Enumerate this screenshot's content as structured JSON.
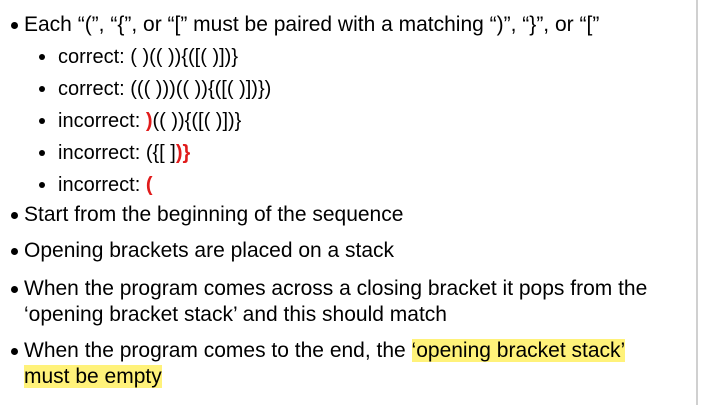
{
  "slide": {
    "b1": "Each “(”, “{”, or “[” must be paired with a matching “)”, “}”, or “[”",
    "sub": [
      {
        "prefix": "correct: ",
        "red": "",
        "rest": "( )(( )){([( )])}"
      },
      {
        "prefix": "correct: ",
        "red": "",
        "rest": "((( )))(( )){([( )])})"
      },
      {
        "prefix": "incorrect: ",
        "red": ")",
        "rest": "(( )){([( )])}"
      },
      {
        "prefix": "incorrect: ",
        "red": "",
        "rest": "({[ ])",
        "red_tail": "}"
      },
      {
        "prefix": "incorrect: ",
        "red": "(",
        "rest": ""
      }
    ],
    "b2": "Start from the beginning of the sequence",
    "b3": "Opening brackets are placed on a stack",
    "b4_line1": "When the program comes across a closing bracket it pops from the",
    "b4_line2": "‘opening bracket stack’ and this should match",
    "b5_line1_plain": "When the program comes to the end, the ",
    "b5_line1_highlight": "‘opening bracket stack’",
    "b5_line2_highlight": "must be empty"
  },
  "colors": {
    "error_red": "#e01b1b",
    "highlight_yellow": "#fff27a"
  }
}
